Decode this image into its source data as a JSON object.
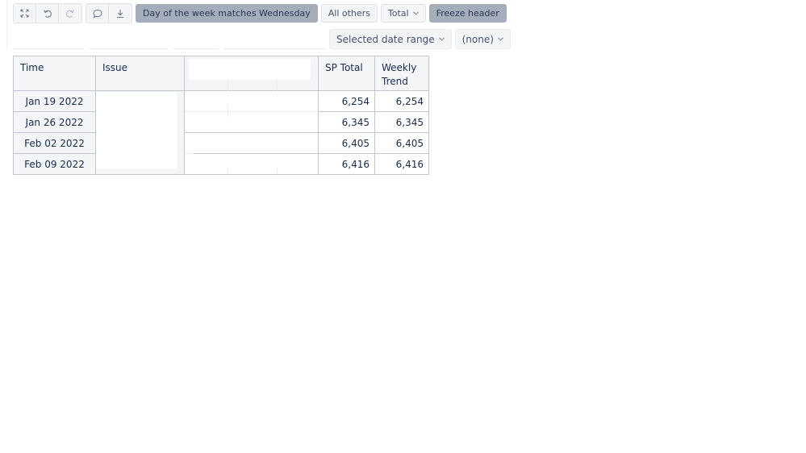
{
  "toolbar": {
    "icons": [
      {
        "name": "fullscreen-icon"
      },
      {
        "name": "undo-icon"
      },
      {
        "name": "redo-icon"
      },
      {
        "name": "comment-icon"
      },
      {
        "name": "download-icon"
      }
    ],
    "filter_label": "Day of the week matches Wednesday",
    "all_others_label": "All others",
    "total_label": "Total",
    "freeze_header_label": "Freeze header"
  },
  "selectors": {
    "date_range": "Selected date range",
    "none": "(none)"
  },
  "table": {
    "headers": {
      "time": "Time",
      "issue": "Issue",
      "sp_total": "SP Total",
      "weekly_trend_line1": "Weekly",
      "weekly_trend_line2": "Trend"
    },
    "rows": [
      {
        "time": "Jan 19 2022",
        "sp_total": "6,254",
        "weekly_trend": "6,254"
      },
      {
        "time": "Jan 26 2022",
        "sp_total": "6,345",
        "weekly_trend": "6,345"
      },
      {
        "time": "Feb 02 2022",
        "sp_total": "6,405",
        "weekly_trend": "6,405"
      },
      {
        "time": "Feb 09 2022",
        "sp_total": "6,416",
        "weekly_trend": "6,416"
      }
    ]
  },
  "colors": {
    "active_button": "#a5adba",
    "button_bg": "#f4f5f7",
    "border": "#c1c7d0",
    "text": "#172b4d"
  }
}
